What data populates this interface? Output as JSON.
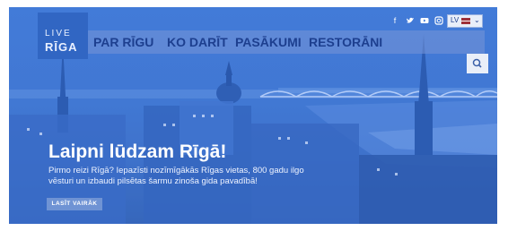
{
  "brand": {
    "line1": "LIVE",
    "line2": "RĪGA"
  },
  "nav": {
    "items": [
      "PAR RĪGU",
      "KO DARĪT",
      "PASĀKUMI",
      "RESTORĀNI"
    ]
  },
  "social": {
    "icons": [
      "facebook-icon",
      "twitter-icon",
      "youtube-icon",
      "instagram-icon"
    ]
  },
  "language": {
    "code": "LV"
  },
  "hero": {
    "title": "Laipni lūdzam Rīgā!",
    "text": "Pirmo reizi Rīgā? Iepazīsti nozīmīgākās Rīgas vietas, 800 gadu ilgo vēsturi un izbaudi pilsētas šarmu zinoša gida pavadībā!",
    "cta": "LASĪT VAIRĀK"
  },
  "colors": {
    "overlay": "#3f78d6",
    "nav_text": "#1d3f8f",
    "cta_bg": "#6f93d4"
  }
}
